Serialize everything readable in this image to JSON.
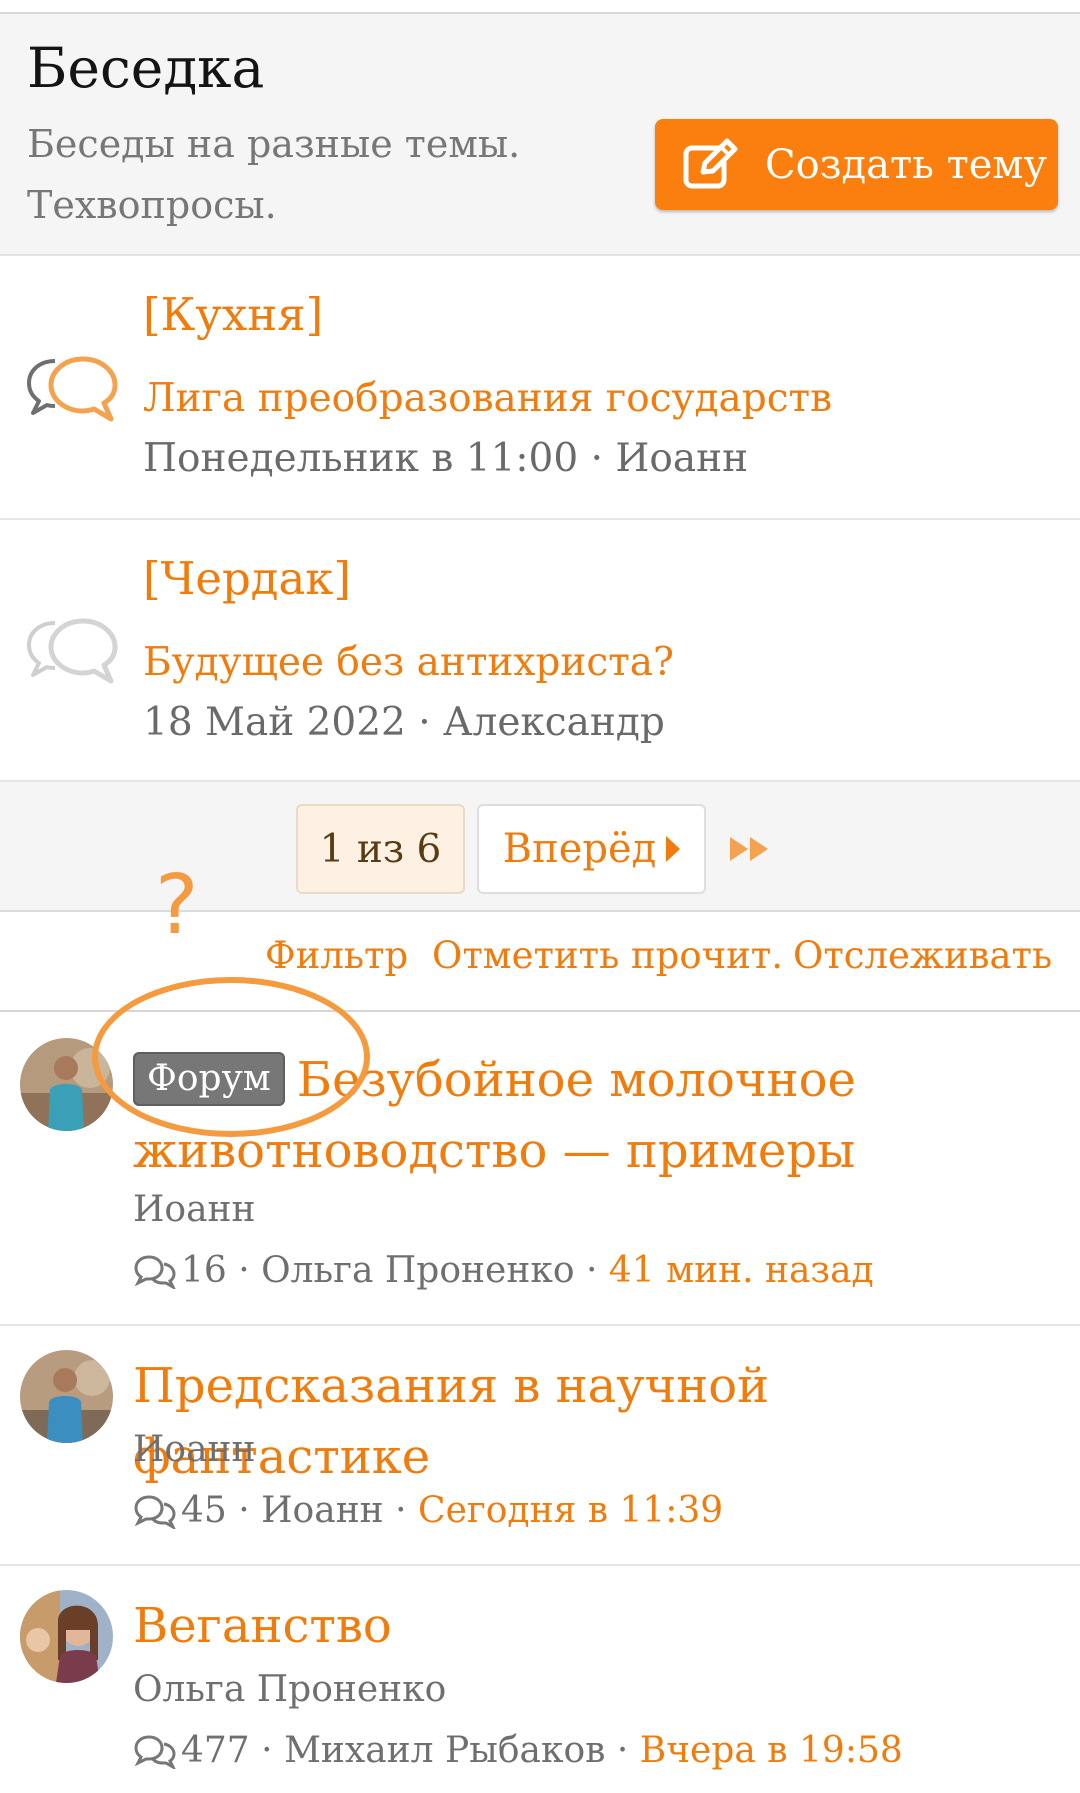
{
  "header": {
    "title": "Беседка",
    "description": "Беседы на разные темы. Техвопросы.",
    "create_label": "Создать тему"
  },
  "sticky": [
    {
      "node": "[Кухня]",
      "title": "Лига преобразования государств",
      "meta": "Понедельник в 11:00 · Иоанн"
    },
    {
      "node": "[Чердак]",
      "title": "Будущее без антихриста?",
      "meta": "18 Май 2022 · Александр"
    }
  ],
  "pagination": {
    "current": "1 из 6",
    "next_label": "Вперёд"
  },
  "toolbar": {
    "filter": "Фильтр",
    "mark_read": "Отметить прочит.",
    "watch": "Отслеживать"
  },
  "annotation": {
    "mark": "?"
  },
  "threads": [
    {
      "prefix": "Форум",
      "title": "Безубойное молочное животноводство — примеры",
      "author": "Иоанн",
      "replies": "16",
      "last_poster": "Ольга Проненко",
      "time": "41 мин. назад"
    },
    {
      "title": "Предсказания в научной фантастике",
      "author": "Иоанн",
      "replies": "45",
      "last_poster": "Иоанн",
      "time": "Сегодня в 11:39"
    },
    {
      "title": "Веганство",
      "author": "Ольга Проненко",
      "replies": "477",
      "last_poster": "Михаил Рыбаков",
      "time": "Вчера в 19:58"
    }
  ],
  "colors": {
    "accent": "#f07c0e",
    "button": "#fb7f0f",
    "annotation": "#f59b3f"
  },
  "icons": {
    "create": "edit-icon",
    "sticky": "chat-bubbles-icon",
    "last_page": "double-chevron-right-icon",
    "replies": "replies-icon"
  }
}
